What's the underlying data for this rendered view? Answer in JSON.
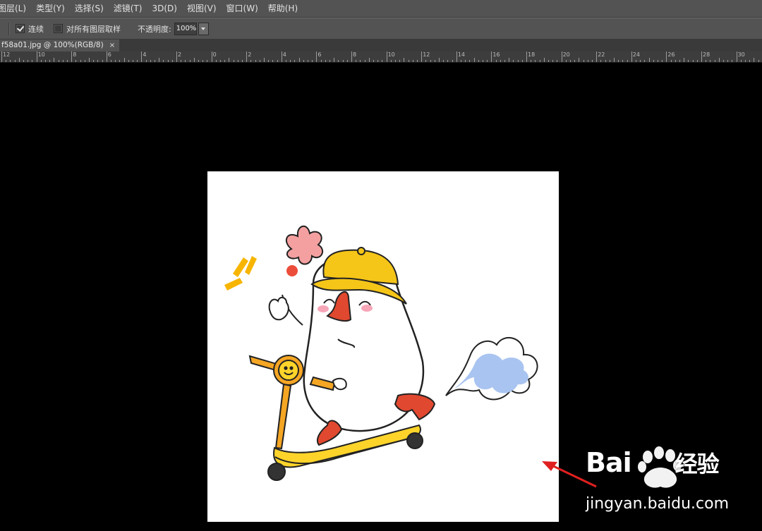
{
  "menu": {
    "items": [
      "图层(L)",
      "类型(Y)",
      "选择(S)",
      "滤镜(T)",
      "3D(D)",
      "视图(V)",
      "窗口(W)",
      "帮助(H)"
    ]
  },
  "options": {
    "contiguous_label": "连续",
    "contiguous_checked": true,
    "sample_all_layers_label": "对所有图层取样",
    "sample_all_layers_checked": false,
    "opacity_label": "不透明度:",
    "opacity_value": "100%"
  },
  "document": {
    "tab_title": "f58a01.jpg @ 100%(RGB/8)",
    "close_glyph": "×"
  },
  "ruler": {
    "labels": [
      "12",
      "10",
      "8",
      "6",
      "4",
      "2",
      "0",
      "2",
      "4",
      "6",
      "8",
      "10",
      "12",
      "14",
      "16",
      "18",
      "20",
      "22",
      "24",
      "26",
      "28",
      "30"
    ]
  },
  "watermark": {
    "brand_text": "Bai",
    "brand_cn": "经验",
    "url": "jingyan.baidu.com"
  },
  "colors": {
    "arrow": "#e02020",
    "hat": "#f5c518",
    "scooter": "#f5c518",
    "boot": "#e0482f",
    "cloud": "#a9c4f0",
    "flower": "#f4a0a0"
  }
}
